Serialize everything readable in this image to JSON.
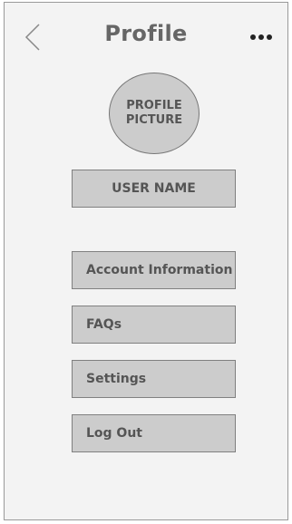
{
  "header": {
    "title": "Profile",
    "back_icon": "chevron-left-icon",
    "more_icon": "more-horizontal-icon"
  },
  "profile": {
    "picture_label": "PROFILE PICTURE",
    "user_name": "USER NAME"
  },
  "menu": {
    "items": [
      {
        "label": "Account Information"
      },
      {
        "label": "FAQs"
      },
      {
        "label": "Settings"
      },
      {
        "label": "Log Out"
      }
    ]
  },
  "colors": {
    "box_fill": "#cccccc",
    "text_gray": "#555555",
    "background": "#f3f3f3"
  }
}
